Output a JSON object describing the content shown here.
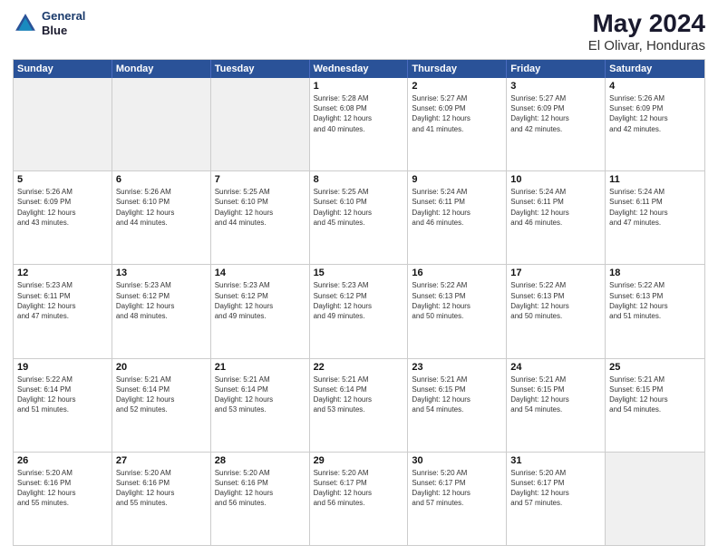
{
  "logo": {
    "line1": "General",
    "line2": "Blue"
  },
  "title": "May 2024",
  "subtitle": "El Olivar, Honduras",
  "header_days": [
    "Sunday",
    "Monday",
    "Tuesday",
    "Wednesday",
    "Thursday",
    "Friday",
    "Saturday"
  ],
  "weeks": [
    [
      {
        "day": "",
        "lines": [],
        "shaded": true
      },
      {
        "day": "",
        "lines": [],
        "shaded": true
      },
      {
        "day": "",
        "lines": [],
        "shaded": true
      },
      {
        "day": "1",
        "lines": [
          "Sunrise: 5:28 AM",
          "Sunset: 6:08 PM",
          "Daylight: 12 hours",
          "and 40 minutes."
        ],
        "shaded": false
      },
      {
        "day": "2",
        "lines": [
          "Sunrise: 5:27 AM",
          "Sunset: 6:09 PM",
          "Daylight: 12 hours",
          "and 41 minutes."
        ],
        "shaded": false
      },
      {
        "day": "3",
        "lines": [
          "Sunrise: 5:27 AM",
          "Sunset: 6:09 PM",
          "Daylight: 12 hours",
          "and 42 minutes."
        ],
        "shaded": false
      },
      {
        "day": "4",
        "lines": [
          "Sunrise: 5:26 AM",
          "Sunset: 6:09 PM",
          "Daylight: 12 hours",
          "and 42 minutes."
        ],
        "shaded": false
      }
    ],
    [
      {
        "day": "5",
        "lines": [
          "Sunrise: 5:26 AM",
          "Sunset: 6:09 PM",
          "Daylight: 12 hours",
          "and 43 minutes."
        ],
        "shaded": false
      },
      {
        "day": "6",
        "lines": [
          "Sunrise: 5:26 AM",
          "Sunset: 6:10 PM",
          "Daylight: 12 hours",
          "and 44 minutes."
        ],
        "shaded": false
      },
      {
        "day": "7",
        "lines": [
          "Sunrise: 5:25 AM",
          "Sunset: 6:10 PM",
          "Daylight: 12 hours",
          "and 44 minutes."
        ],
        "shaded": false
      },
      {
        "day": "8",
        "lines": [
          "Sunrise: 5:25 AM",
          "Sunset: 6:10 PM",
          "Daylight: 12 hours",
          "and 45 minutes."
        ],
        "shaded": false
      },
      {
        "day": "9",
        "lines": [
          "Sunrise: 5:24 AM",
          "Sunset: 6:11 PM",
          "Daylight: 12 hours",
          "and 46 minutes."
        ],
        "shaded": false
      },
      {
        "day": "10",
        "lines": [
          "Sunrise: 5:24 AM",
          "Sunset: 6:11 PM",
          "Daylight: 12 hours",
          "and 46 minutes."
        ],
        "shaded": false
      },
      {
        "day": "11",
        "lines": [
          "Sunrise: 5:24 AM",
          "Sunset: 6:11 PM",
          "Daylight: 12 hours",
          "and 47 minutes."
        ],
        "shaded": false
      }
    ],
    [
      {
        "day": "12",
        "lines": [
          "Sunrise: 5:23 AM",
          "Sunset: 6:11 PM",
          "Daylight: 12 hours",
          "and 47 minutes."
        ],
        "shaded": false
      },
      {
        "day": "13",
        "lines": [
          "Sunrise: 5:23 AM",
          "Sunset: 6:12 PM",
          "Daylight: 12 hours",
          "and 48 minutes."
        ],
        "shaded": false
      },
      {
        "day": "14",
        "lines": [
          "Sunrise: 5:23 AM",
          "Sunset: 6:12 PM",
          "Daylight: 12 hours",
          "and 49 minutes."
        ],
        "shaded": false
      },
      {
        "day": "15",
        "lines": [
          "Sunrise: 5:23 AM",
          "Sunset: 6:12 PM",
          "Daylight: 12 hours",
          "and 49 minutes."
        ],
        "shaded": false
      },
      {
        "day": "16",
        "lines": [
          "Sunrise: 5:22 AM",
          "Sunset: 6:13 PM",
          "Daylight: 12 hours",
          "and 50 minutes."
        ],
        "shaded": false
      },
      {
        "day": "17",
        "lines": [
          "Sunrise: 5:22 AM",
          "Sunset: 6:13 PM",
          "Daylight: 12 hours",
          "and 50 minutes."
        ],
        "shaded": false
      },
      {
        "day": "18",
        "lines": [
          "Sunrise: 5:22 AM",
          "Sunset: 6:13 PM",
          "Daylight: 12 hours",
          "and 51 minutes."
        ],
        "shaded": false
      }
    ],
    [
      {
        "day": "19",
        "lines": [
          "Sunrise: 5:22 AM",
          "Sunset: 6:14 PM",
          "Daylight: 12 hours",
          "and 51 minutes."
        ],
        "shaded": false
      },
      {
        "day": "20",
        "lines": [
          "Sunrise: 5:21 AM",
          "Sunset: 6:14 PM",
          "Daylight: 12 hours",
          "and 52 minutes."
        ],
        "shaded": false
      },
      {
        "day": "21",
        "lines": [
          "Sunrise: 5:21 AM",
          "Sunset: 6:14 PM",
          "Daylight: 12 hours",
          "and 53 minutes."
        ],
        "shaded": false
      },
      {
        "day": "22",
        "lines": [
          "Sunrise: 5:21 AM",
          "Sunset: 6:14 PM",
          "Daylight: 12 hours",
          "and 53 minutes."
        ],
        "shaded": false
      },
      {
        "day": "23",
        "lines": [
          "Sunrise: 5:21 AM",
          "Sunset: 6:15 PM",
          "Daylight: 12 hours",
          "and 54 minutes."
        ],
        "shaded": false
      },
      {
        "day": "24",
        "lines": [
          "Sunrise: 5:21 AM",
          "Sunset: 6:15 PM",
          "Daylight: 12 hours",
          "and 54 minutes."
        ],
        "shaded": false
      },
      {
        "day": "25",
        "lines": [
          "Sunrise: 5:21 AM",
          "Sunset: 6:15 PM",
          "Daylight: 12 hours",
          "and 54 minutes."
        ],
        "shaded": false
      }
    ],
    [
      {
        "day": "26",
        "lines": [
          "Sunrise: 5:20 AM",
          "Sunset: 6:16 PM",
          "Daylight: 12 hours",
          "and 55 minutes."
        ],
        "shaded": false
      },
      {
        "day": "27",
        "lines": [
          "Sunrise: 5:20 AM",
          "Sunset: 6:16 PM",
          "Daylight: 12 hours",
          "and 55 minutes."
        ],
        "shaded": false
      },
      {
        "day": "28",
        "lines": [
          "Sunrise: 5:20 AM",
          "Sunset: 6:16 PM",
          "Daylight: 12 hours",
          "and 56 minutes."
        ],
        "shaded": false
      },
      {
        "day": "29",
        "lines": [
          "Sunrise: 5:20 AM",
          "Sunset: 6:17 PM",
          "Daylight: 12 hours",
          "and 56 minutes."
        ],
        "shaded": false
      },
      {
        "day": "30",
        "lines": [
          "Sunrise: 5:20 AM",
          "Sunset: 6:17 PM",
          "Daylight: 12 hours",
          "and 57 minutes."
        ],
        "shaded": false
      },
      {
        "day": "31",
        "lines": [
          "Sunrise: 5:20 AM",
          "Sunset: 6:17 PM",
          "Daylight: 12 hours",
          "and 57 minutes."
        ],
        "shaded": false
      },
      {
        "day": "",
        "lines": [],
        "shaded": true
      }
    ]
  ]
}
